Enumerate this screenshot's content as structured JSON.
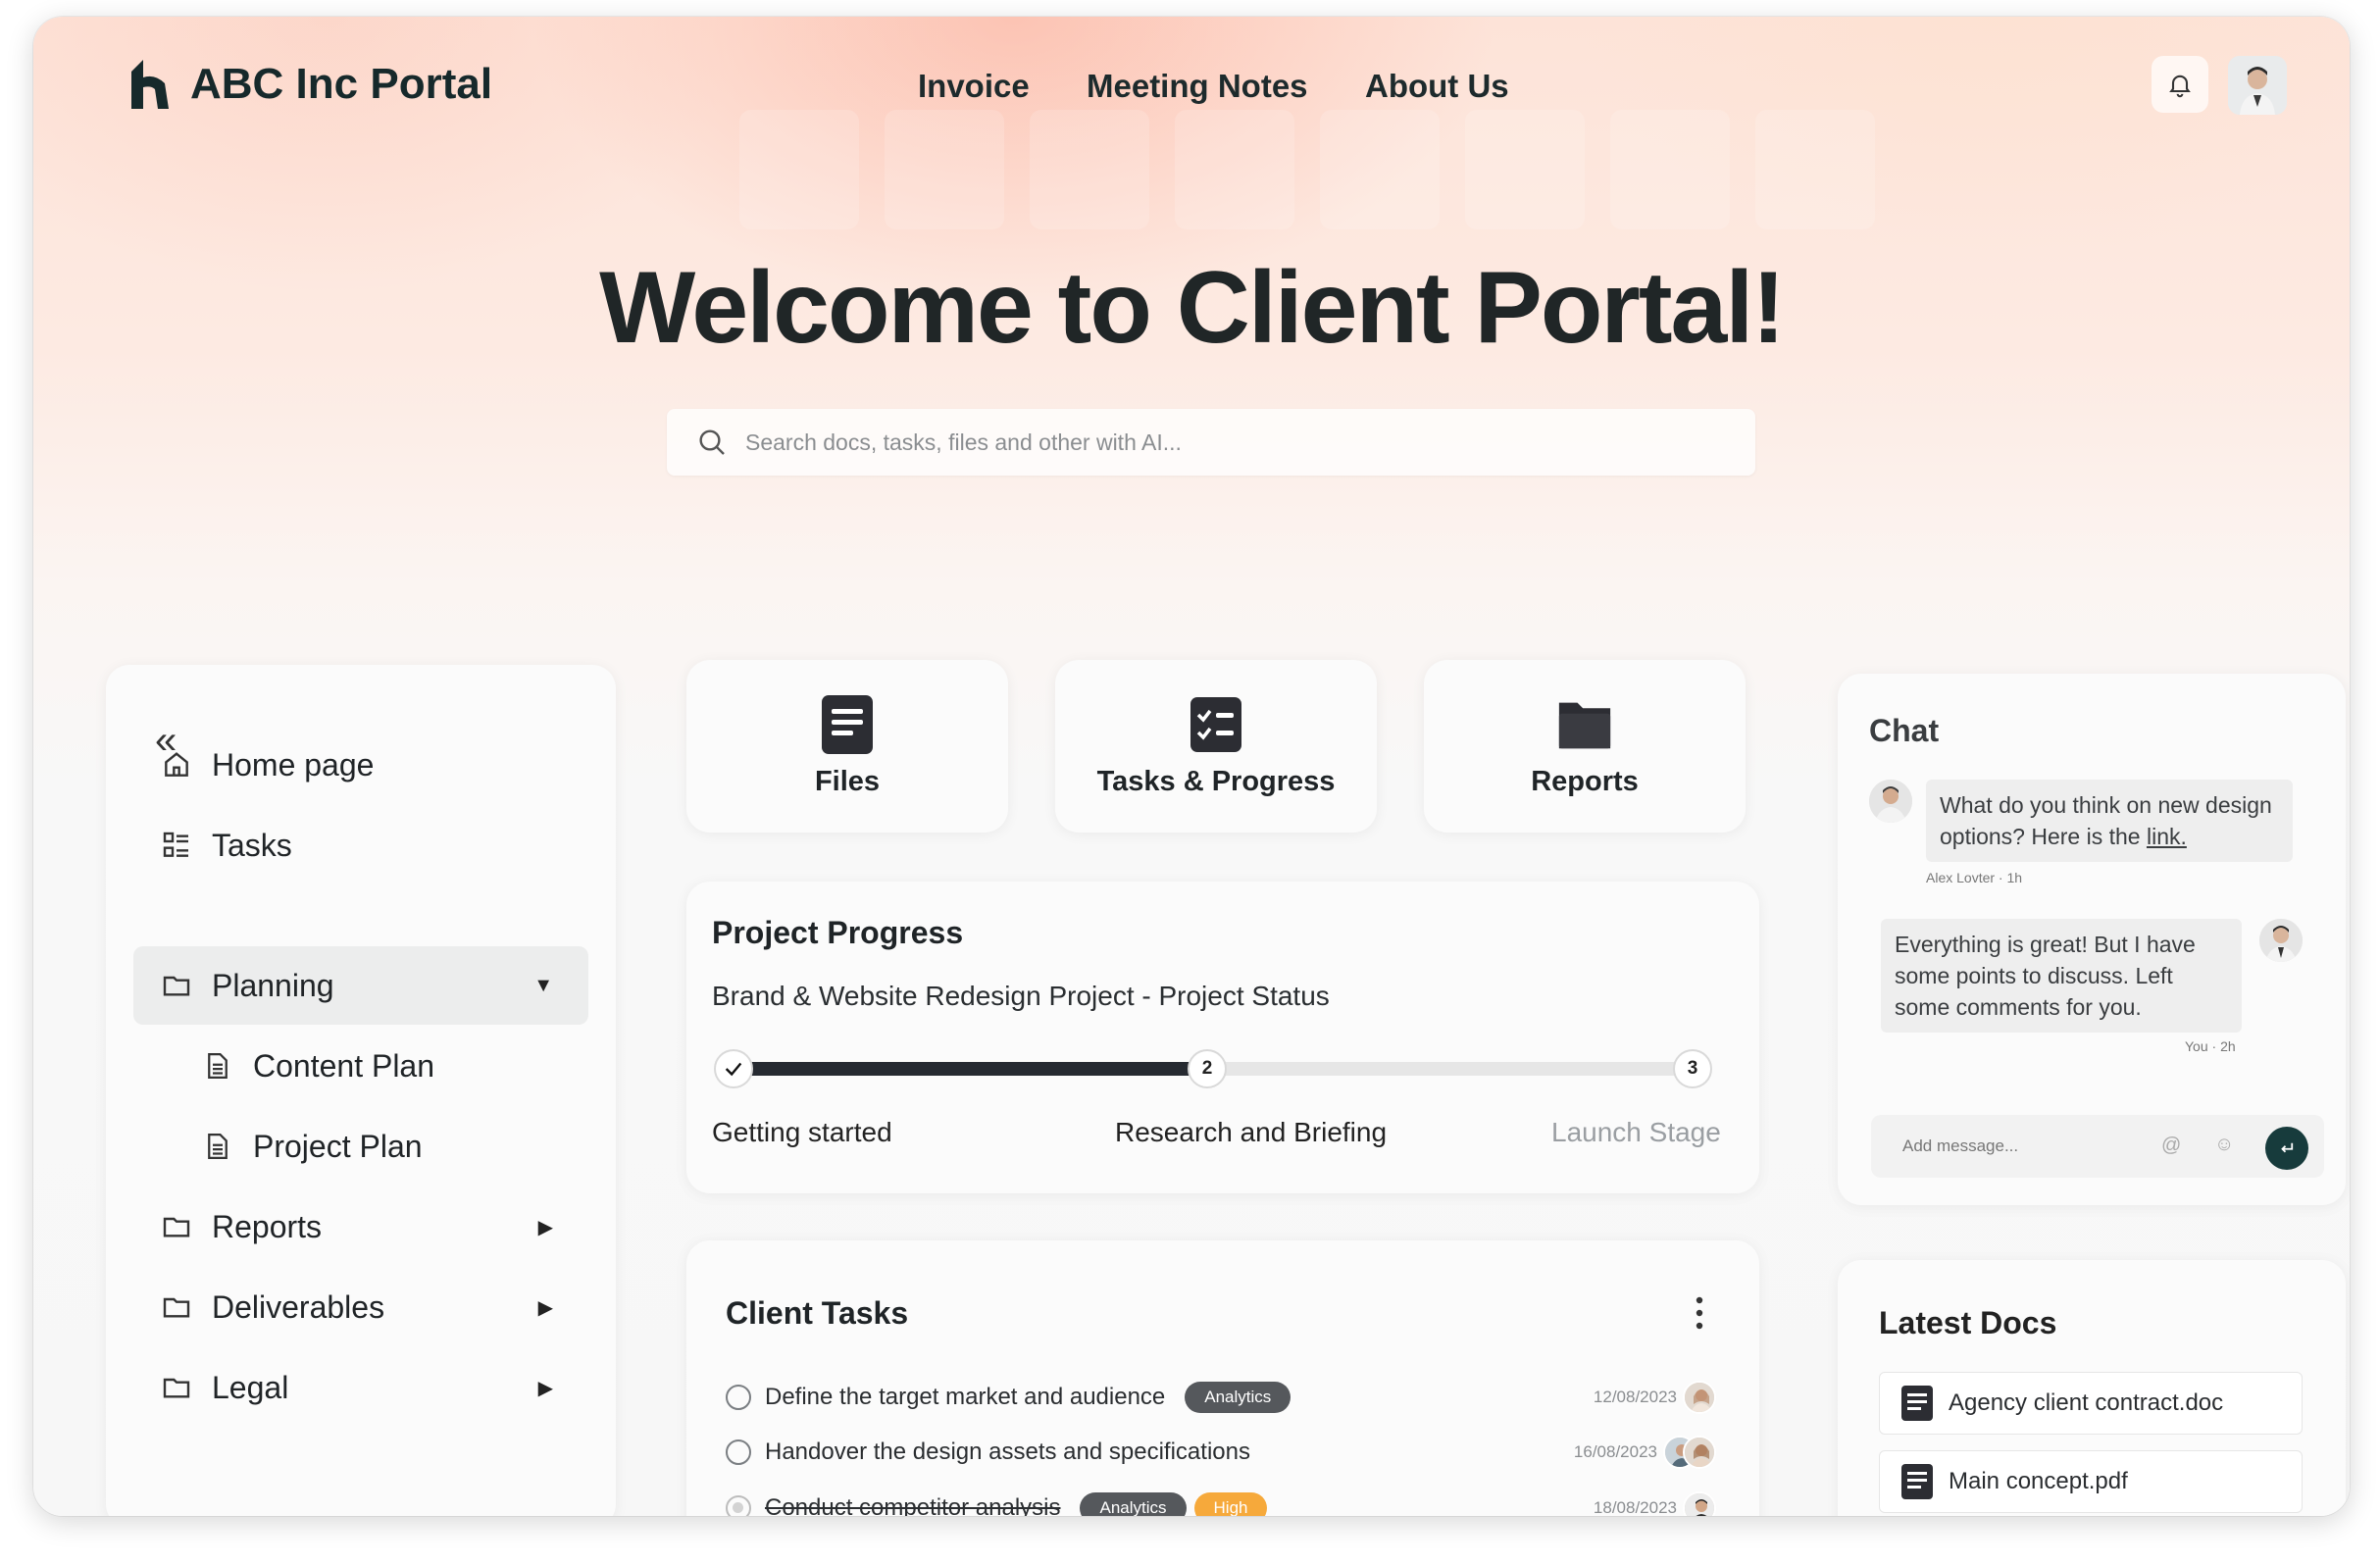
{
  "app": {
    "logo_text": "ABC Inc Portal"
  },
  "nav": {
    "items": [
      {
        "label": "Invoice"
      },
      {
        "label": "Meeting Notes"
      },
      {
        "label": "About Us"
      }
    ]
  },
  "hero": {
    "title": "Welcome to Client Portal!"
  },
  "search": {
    "placeholder": "Search docs, tasks, files and other with AI..."
  },
  "sidebar": {
    "items": [
      {
        "label": "Home page",
        "icon": "home-icon"
      },
      {
        "label": "Tasks",
        "icon": "tasks-icon"
      },
      {
        "label": "Planning",
        "icon": "folder-icon",
        "expanded": true,
        "active": true
      },
      {
        "label": "Content Plan",
        "icon": "document-icon"
      },
      {
        "label": "Project Plan",
        "icon": "document-icon"
      },
      {
        "label": "Reports",
        "icon": "folder-icon"
      },
      {
        "label": "Deliverables",
        "icon": "folder-icon"
      },
      {
        "label": "Legal",
        "icon": "folder-icon"
      }
    ]
  },
  "quick_links": [
    {
      "label": "Files",
      "icon": "file-icon"
    },
    {
      "label": "Tasks & Progress",
      "icon": "checklist-icon"
    },
    {
      "label": "Reports",
      "icon": "folder-icon"
    }
  ],
  "project_progress": {
    "title": "Project Progress",
    "subtitle": "Brand & Website Redesign Project - Project Status",
    "progress_fraction": 0.5,
    "steps": [
      {
        "label": "Getting started",
        "number": "1",
        "state": "done"
      },
      {
        "label": "Research and Briefing",
        "number": "2",
        "state": "current"
      },
      {
        "label": "Launch Stage",
        "number": "3",
        "state": "upcoming"
      }
    ]
  },
  "client_tasks": {
    "title": "Client Tasks",
    "items": [
      {
        "text": "Define the target market and audience",
        "tags": [
          "Analytics"
        ],
        "date": "12/08/2023",
        "done": false
      },
      {
        "text": "Handover the design assets and specifications",
        "tags": [],
        "date": "16/08/2023",
        "done": false
      },
      {
        "text": "Conduct competitor analysis",
        "tags": [
          "Analytics",
          "High"
        ],
        "date": "18/08/2023",
        "done": true
      }
    ]
  },
  "chat": {
    "title": "Chat",
    "messages": [
      {
        "text": "What do you think on new design options? Here is the",
        "link": "link.",
        "meta": "Alex Lovter · 1h"
      },
      {
        "text": "Everything is great! But I have some points to discuss. Left some comments for you.",
        "meta": "You · 2h"
      }
    ],
    "input_placeholder": "Add message..."
  },
  "latest_docs": {
    "title": "Latest Docs",
    "items": [
      {
        "name": "Agency client contract.doc"
      },
      {
        "name": "Main concept.pdf"
      }
    ]
  },
  "colors": {
    "accent_dark": "#173b3c",
    "tag_gray": "#55585c",
    "tag_high": "#f6a93b",
    "progress_fill": "#262a31"
  }
}
